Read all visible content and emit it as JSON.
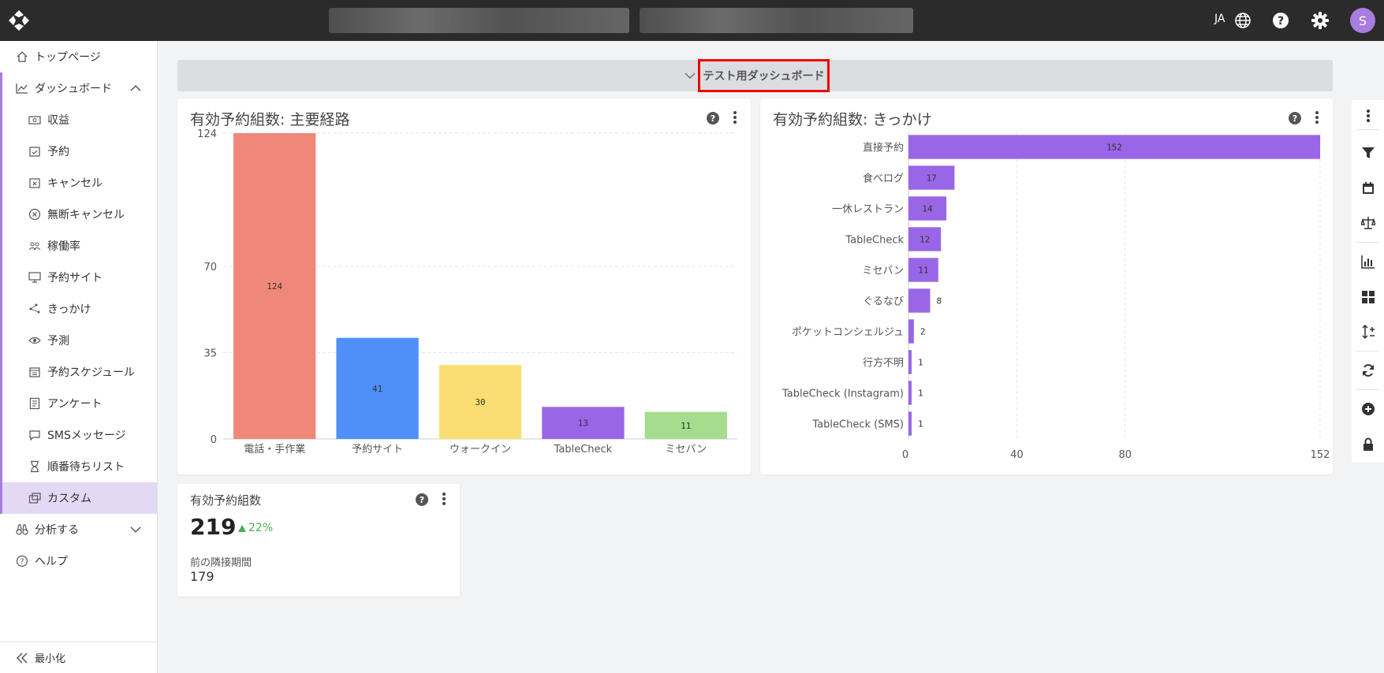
{
  "topbar": {
    "language": "JA",
    "avatar_initial": "S"
  },
  "sidebar": {
    "items": [
      {
        "label": "トップページ"
      },
      {
        "label": "ダッシュボード"
      },
      {
        "label": "収益"
      },
      {
        "label": "予約"
      },
      {
        "label": "キャンセル"
      },
      {
        "label": "無断キャンセル"
      },
      {
        "label": "稼働率"
      },
      {
        "label": "予約サイト"
      },
      {
        "label": "きっかけ"
      },
      {
        "label": "予測"
      },
      {
        "label": "予約スケジュール"
      },
      {
        "label": "アンケート"
      },
      {
        "label": "SMSメッセージ"
      },
      {
        "label": "順番待ちリスト"
      },
      {
        "label": "カスタム"
      },
      {
        "label": "分析する"
      },
      {
        "label": "ヘルプ"
      }
    ],
    "minimize_label": "最小化"
  },
  "dashboard": {
    "title": "テスト用ダッシュボード"
  },
  "cards": {
    "channel": {
      "title": "有効予約組数: 主要経路"
    },
    "trigger": {
      "title": "有効予約組数: きっかけ"
    },
    "kpi": {
      "title": "有効予約組数",
      "value": "219",
      "change": "22%",
      "prev_label": "前の隣接期間",
      "prev_value": "179"
    }
  },
  "colors": {
    "accent": "#a97de0",
    "trend_up": "#4caf50"
  },
  "chart_data": [
    {
      "type": "bar",
      "title": "有効予約組数: 主要経路",
      "categories": [
        "電話・手作業",
        "予約サイト",
        "ウォークイン",
        "TableCheck",
        "ミセバン"
      ],
      "values": [
        124,
        41,
        30,
        13,
        11
      ],
      "colors": [
        "#f0887a",
        "#4f8ff7",
        "#f9df73",
        "#9966e8",
        "#a6dc8e"
      ],
      "yticks": [
        0,
        35,
        70,
        124
      ],
      "ylim": [
        0,
        124
      ],
      "grid": true
    },
    {
      "type": "bar",
      "orientation": "horizontal",
      "title": "有効予約組数: きっかけ",
      "categories": [
        "直接予約",
        "食べログ",
        "一休レストラン",
        "TableCheck",
        "ミセバン",
        "ぐるなび",
        "ポケットコンシェルジュ",
        "行方不明",
        "TableCheck (Instagram)",
        "TableCheck (SMS)"
      ],
      "values": [
        152,
        17,
        14,
        12,
        11,
        8,
        2,
        1,
        1,
        1
      ],
      "color": "#9966e8",
      "xticks": [
        0,
        40,
        80,
        152
      ],
      "xlim": [
        0,
        152
      ],
      "grid": true
    }
  ]
}
